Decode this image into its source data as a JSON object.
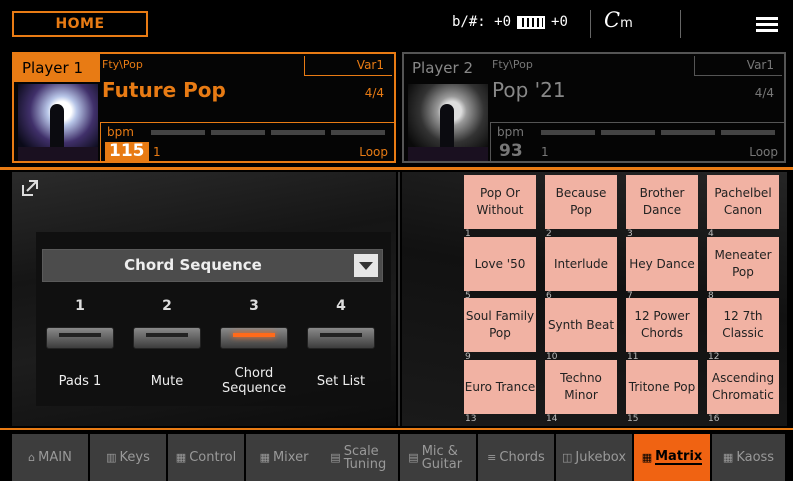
{
  "topbar": {
    "home_label": "HOME",
    "transpose_text": "b/#: +0",
    "keyboard_text": "+0",
    "chord_root": "C",
    "chord_quality": "m"
  },
  "player1": {
    "tag": "Player 1",
    "category": "Fty\\Pop",
    "variation": "Var1",
    "style_name": "Future Pop",
    "meter": "4/4",
    "bpm_label": "bpm",
    "bpm": "115",
    "bar": "1",
    "loop_label": "Loop"
  },
  "player2": {
    "tag": "Player 2",
    "category": "Fty\\Pop",
    "variation": "Var1",
    "style_name": "Pop '21",
    "meter": "4/4",
    "bpm_label": "bpm",
    "bpm": "93",
    "bar": "1",
    "loop_label": "Loop"
  },
  "pads": {
    "selector_value": "Chord Sequence",
    "items": [
      {
        "num": "1",
        "label": "Pads 1",
        "active": false
      },
      {
        "num": "2",
        "label": "Mute",
        "active": false
      },
      {
        "num": "3",
        "label": "Chord Sequence",
        "active": true
      },
      {
        "num": "4",
        "label": "Set List",
        "active": false
      }
    ]
  },
  "matrix": {
    "cells": [
      {
        "num": "1",
        "label": "Pop Or Without"
      },
      {
        "num": "2",
        "label": "Because Pop"
      },
      {
        "num": "3",
        "label": "Brother Dance"
      },
      {
        "num": "4",
        "label": "Pachelbel Canon"
      },
      {
        "num": "5",
        "label": "Love '50"
      },
      {
        "num": "6",
        "label": "Interlude"
      },
      {
        "num": "7",
        "label": "Hey Dance"
      },
      {
        "num": "8",
        "label": "Meneater Pop"
      },
      {
        "num": "9",
        "label": "Soul Family Pop"
      },
      {
        "num": "10",
        "label": "Synth Beat"
      },
      {
        "num": "11",
        "label": "12 Power Chords"
      },
      {
        "num": "12",
        "label": "12 7th Classic"
      },
      {
        "num": "13",
        "label": "Euro Trance"
      },
      {
        "num": "14",
        "label": "Techno Minor"
      },
      {
        "num": "15",
        "label": "Tritone Pop"
      },
      {
        "num": "16",
        "label": "Ascending Chromatic"
      }
    ]
  },
  "nav": {
    "tabs": [
      {
        "label": "MAIN",
        "icon": "⌂",
        "active": false
      },
      {
        "label": "Keys",
        "icon": "▥",
        "active": false
      },
      {
        "label": "Control",
        "icon": "▦",
        "active": false
      },
      {
        "label": "Mixer",
        "icon": "▦",
        "active": false
      },
      {
        "label": "Scale Tuning",
        "icon": "▤",
        "active": false
      },
      {
        "label": "Mic & Guitar",
        "icon": "▤",
        "active": false
      },
      {
        "label": "Chords",
        "icon": "≡",
        "active": false
      },
      {
        "label": "Jukebox",
        "icon": "◫",
        "active": false
      },
      {
        "label": "Matrix",
        "icon": "▦",
        "active": true
      },
      {
        "label": "Kaoss",
        "icon": "▦",
        "active": false
      }
    ]
  }
}
